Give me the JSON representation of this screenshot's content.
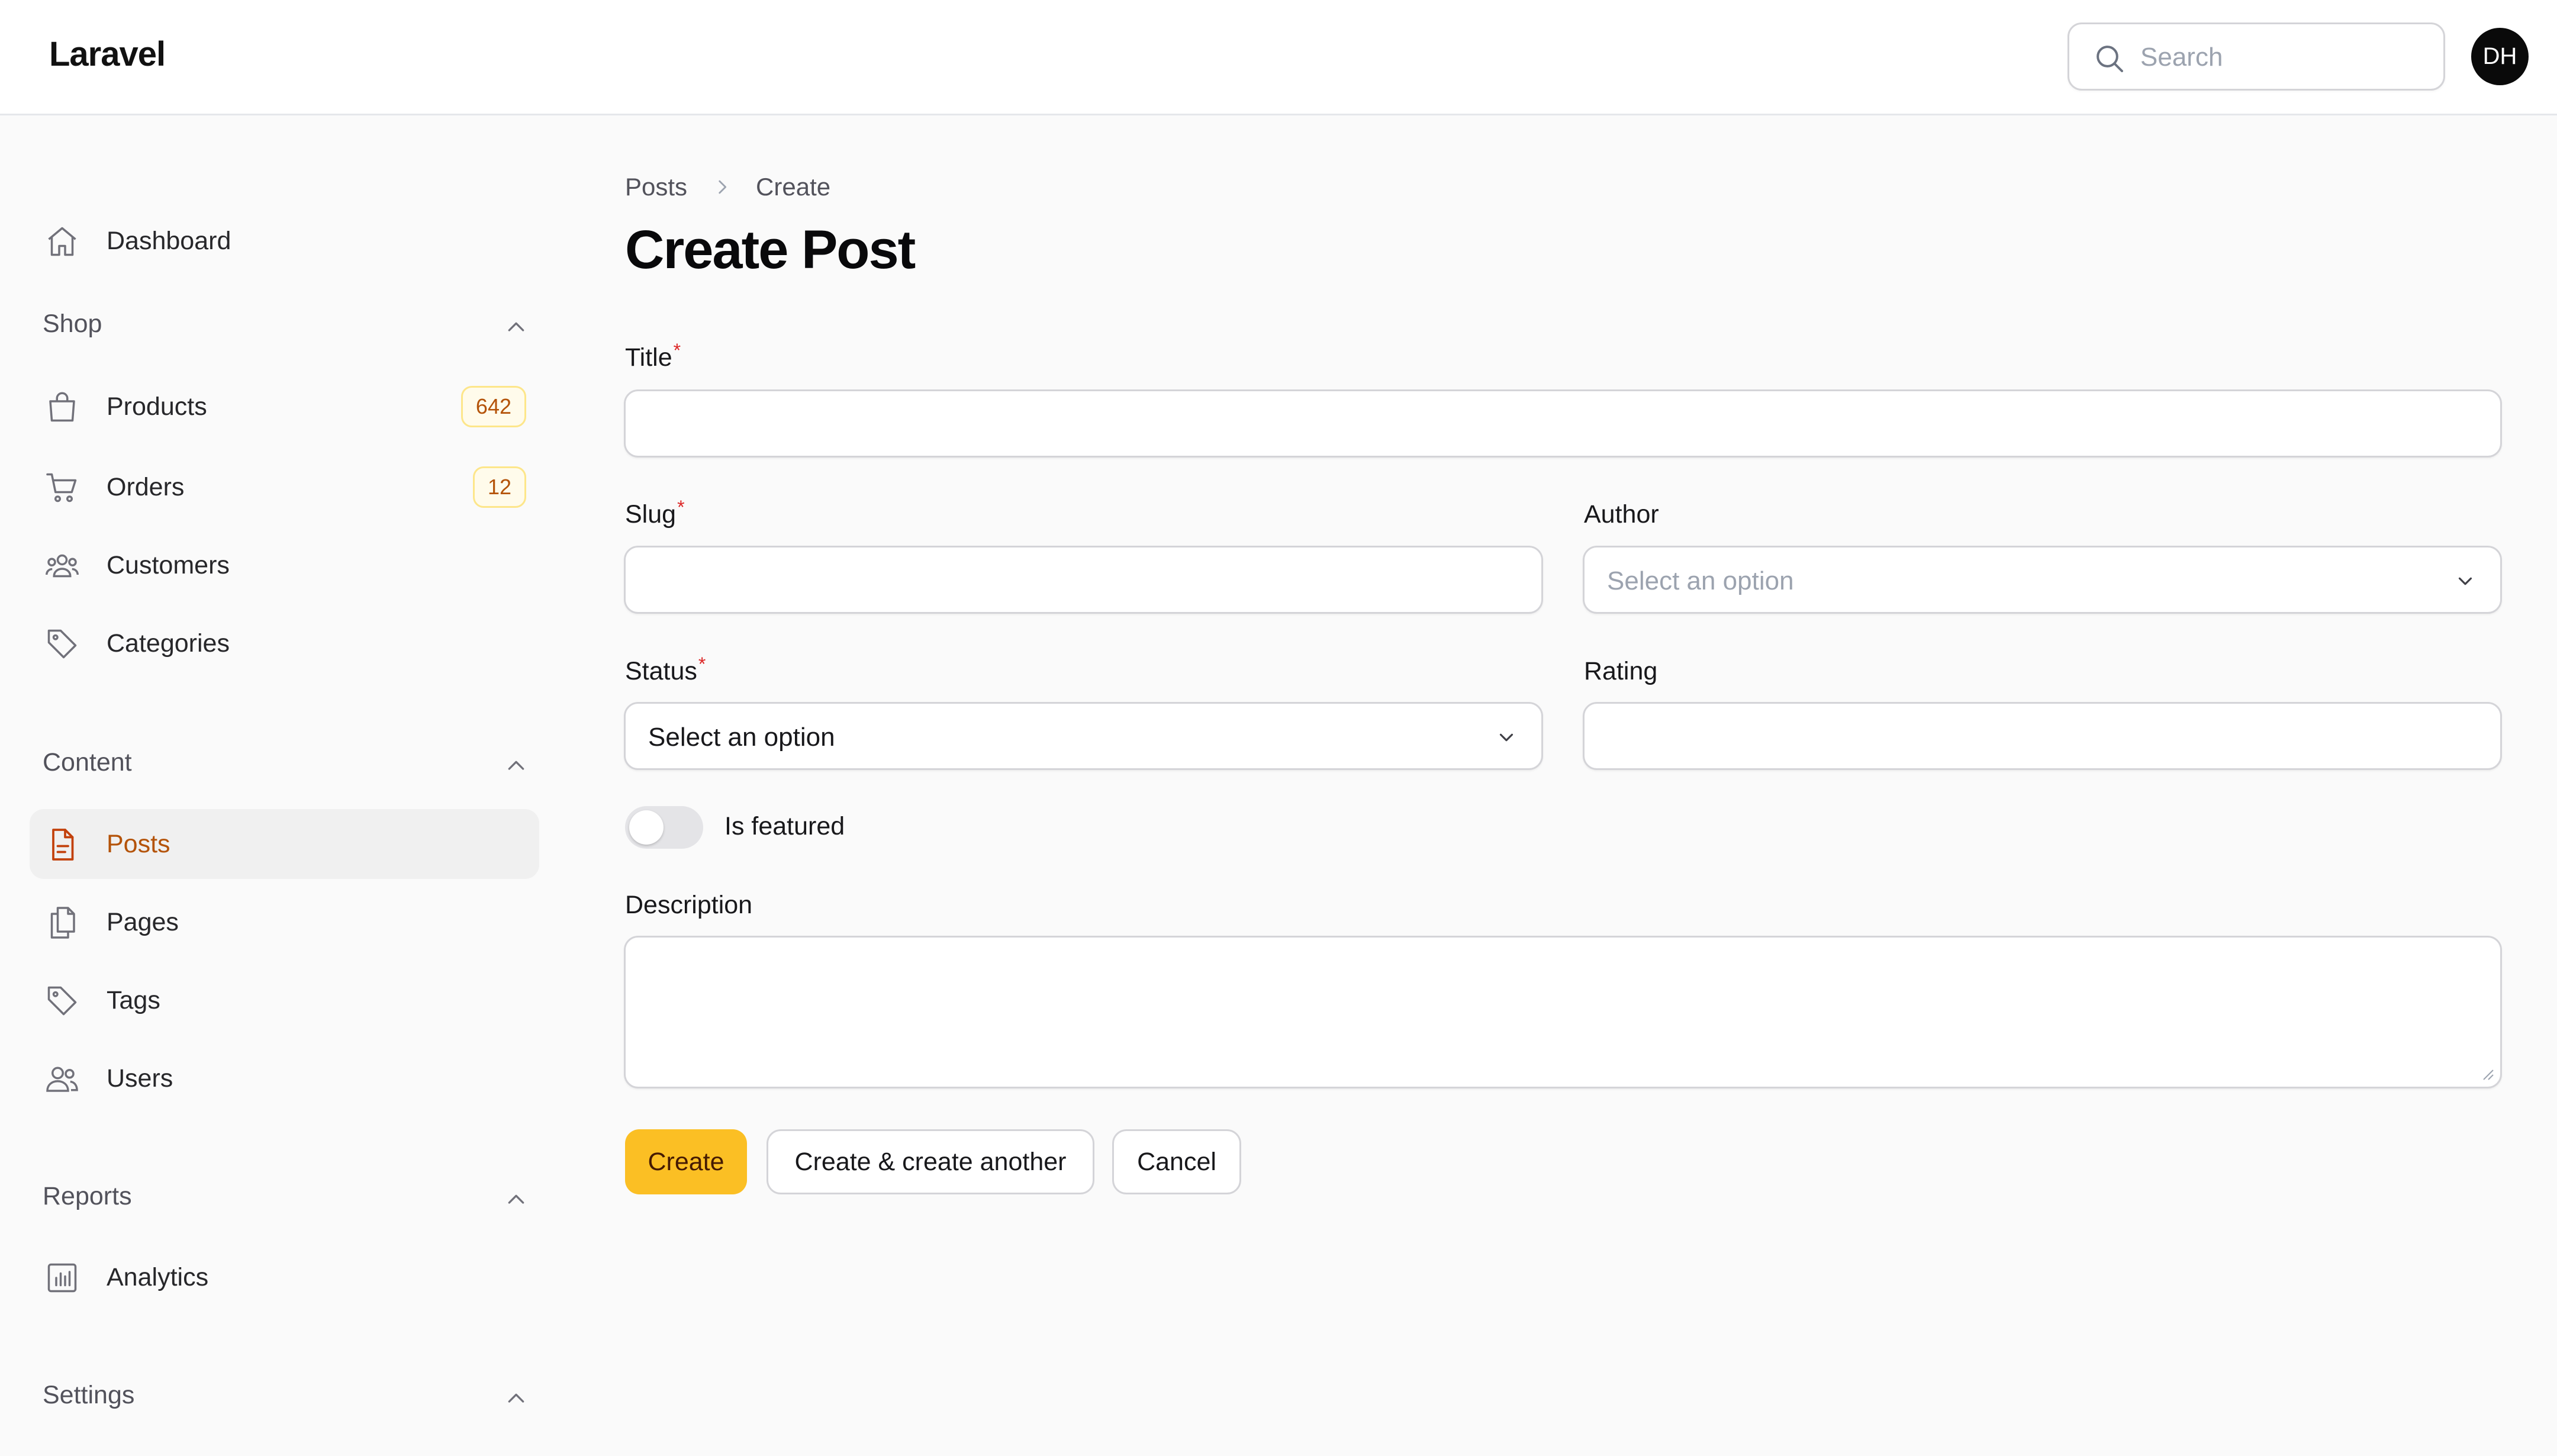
{
  "topbar": {
    "brand": "Laravel",
    "search_placeholder": "Search",
    "avatar_initials": "DH"
  },
  "sidebar": {
    "dashboard": "Dashboard",
    "groups": {
      "shop": "Shop",
      "content": "Content",
      "reports": "Reports",
      "settings": "Settings"
    },
    "items": {
      "products": {
        "label": "Products",
        "badge": "642"
      },
      "orders": {
        "label": "Orders",
        "badge": "12"
      },
      "customers": {
        "label": "Customers"
      },
      "categories": {
        "label": "Categories"
      },
      "posts": {
        "label": "Posts"
      },
      "pages": {
        "label": "Pages"
      },
      "tags": {
        "label": "Tags"
      },
      "users": {
        "label": "Users"
      },
      "analytics": {
        "label": "Analytics"
      }
    },
    "active_item": "posts"
  },
  "breadcrumb": [
    "Posts",
    "Create"
  ],
  "page_title": "Create Post",
  "form": {
    "title": {
      "label": "Title",
      "required_mark": "*",
      "value": ""
    },
    "slug": {
      "label": "Slug",
      "required_mark": "*",
      "value": ""
    },
    "author": {
      "label": "Author",
      "placeholder": "Select an option"
    },
    "status": {
      "label": "Status",
      "required_mark": "*",
      "selected": "Select an option"
    },
    "rating": {
      "label": "Rating",
      "value": ""
    },
    "is_featured": {
      "label": "Is featured",
      "on": false
    },
    "description": {
      "label": "Description",
      "value": ""
    }
  },
  "buttons": {
    "create": "Create",
    "create_another": "Create & create another",
    "cancel": "Cancel"
  },
  "colors": {
    "accent": "#fbbf24",
    "active_text": "#b45309",
    "required": "#dc2626"
  }
}
